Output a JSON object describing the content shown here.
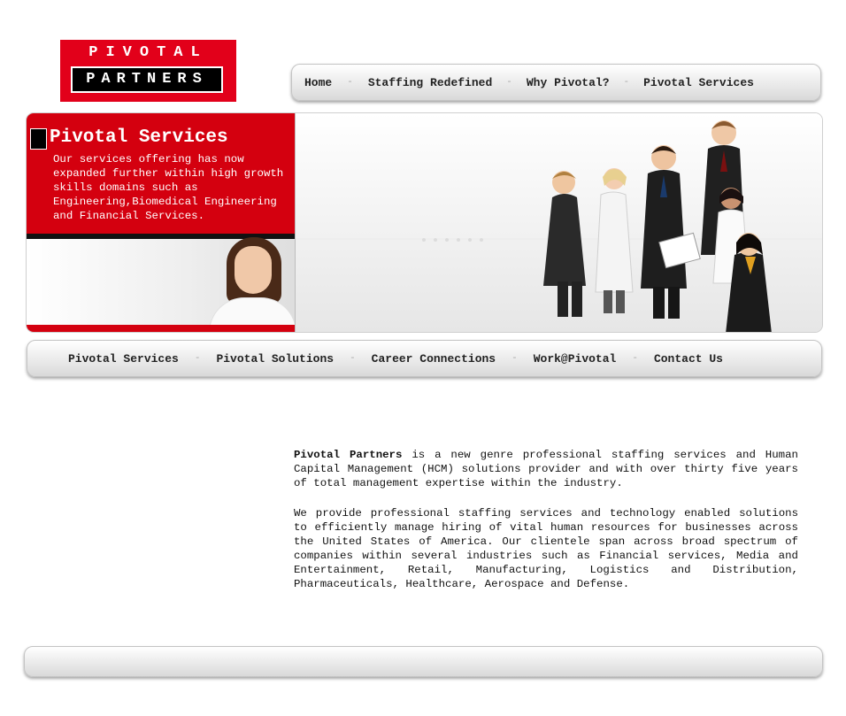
{
  "logo": {
    "line1": "PIVOTAL",
    "line2": "PARTNERS",
    "color": "#e2001a"
  },
  "top_nav": [
    {
      "label": "Home"
    },
    {
      "label": "Staffing Redefined"
    },
    {
      "label": "Why Pivotal?"
    },
    {
      "label": "Pivotal Services"
    }
  ],
  "nav_separator": "-",
  "hero": {
    "title": "Pivotal Services",
    "text": "Our services offering has now expanded further within high growth skills domains such as Engineering,Biomedical Engineering and Financial Services.",
    "accent": "#d4000f"
  },
  "secondary_nav": [
    {
      "label": "Pivotal Services"
    },
    {
      "label": "Pivotal Solutions"
    },
    {
      "label": "Career Connections"
    },
    {
      "label": "Work@Pivotal"
    },
    {
      "label": "Contact Us"
    }
  ],
  "content": {
    "p1_strong": "Pivotal Partners",
    "p1_rest": " is a new genre professional staffing services and Human Capital Management (HCM) solutions provider and with over thirty five years of total management expertise within the industry.",
    "p2": "We provide professional staffing services and technology enabled solutions to efficiently manage hiring of vital human resources for businesses across the United States of America. Our clientele span across broad spectrum of companies within several industries such as Financial services, Media and Entertainment, Retail, Manufacturing, Logistics and Distribution, Pharmaceuticals, Healthcare, Aerospace and Defense."
  }
}
